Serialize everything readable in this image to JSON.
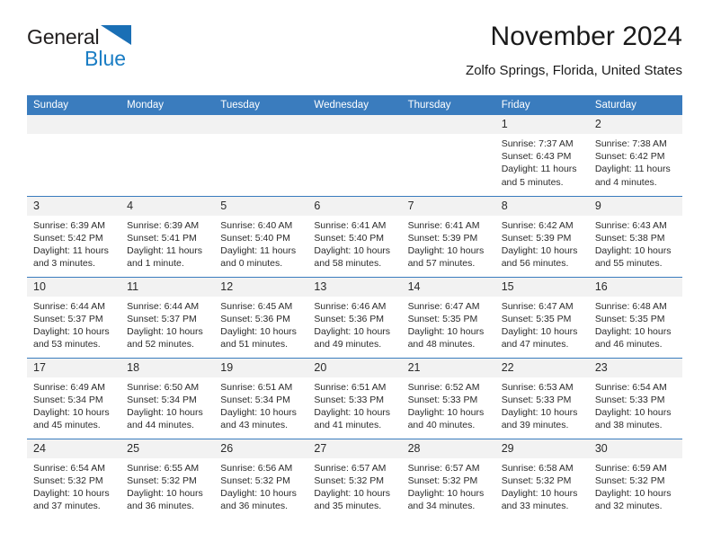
{
  "brand": {
    "name_part1": "General",
    "name_part2": "Blue",
    "logo_icon": "triangle-logo-icon",
    "accent_color": "#1a7dc4"
  },
  "header": {
    "title": "November 2024",
    "location": "Zolfo Springs, Florida, United States"
  },
  "theme": {
    "header_blue": "#3a7cbe",
    "daynum_bg": "#f2f2f2",
    "text": "#2b2b2b"
  },
  "calendar": {
    "weekday_headers": [
      "Sunday",
      "Monday",
      "Tuesday",
      "Wednesday",
      "Thursday",
      "Friday",
      "Saturday"
    ],
    "weeks": [
      [
        {
          "day": "",
          "sunrise": "",
          "sunset": "",
          "daylight_line1": "",
          "daylight_line2": ""
        },
        {
          "day": "",
          "sunrise": "",
          "sunset": "",
          "daylight_line1": "",
          "daylight_line2": ""
        },
        {
          "day": "",
          "sunrise": "",
          "sunset": "",
          "daylight_line1": "",
          "daylight_line2": ""
        },
        {
          "day": "",
          "sunrise": "",
          "sunset": "",
          "daylight_line1": "",
          "daylight_line2": ""
        },
        {
          "day": "",
          "sunrise": "",
          "sunset": "",
          "daylight_line1": "",
          "daylight_line2": ""
        },
        {
          "day": "1",
          "sunrise": "Sunrise: 7:37 AM",
          "sunset": "Sunset: 6:43 PM",
          "daylight_line1": "Daylight: 11 hours",
          "daylight_line2": "and 5 minutes."
        },
        {
          "day": "2",
          "sunrise": "Sunrise: 7:38 AM",
          "sunset": "Sunset: 6:42 PM",
          "daylight_line1": "Daylight: 11 hours",
          "daylight_line2": "and 4 minutes."
        }
      ],
      [
        {
          "day": "3",
          "sunrise": "Sunrise: 6:39 AM",
          "sunset": "Sunset: 5:42 PM",
          "daylight_line1": "Daylight: 11 hours",
          "daylight_line2": "and 3 minutes."
        },
        {
          "day": "4",
          "sunrise": "Sunrise: 6:39 AM",
          "sunset": "Sunset: 5:41 PM",
          "daylight_line1": "Daylight: 11 hours",
          "daylight_line2": "and 1 minute."
        },
        {
          "day": "5",
          "sunrise": "Sunrise: 6:40 AM",
          "sunset": "Sunset: 5:40 PM",
          "daylight_line1": "Daylight: 11 hours",
          "daylight_line2": "and 0 minutes."
        },
        {
          "day": "6",
          "sunrise": "Sunrise: 6:41 AM",
          "sunset": "Sunset: 5:40 PM",
          "daylight_line1": "Daylight: 10 hours",
          "daylight_line2": "and 58 minutes."
        },
        {
          "day": "7",
          "sunrise": "Sunrise: 6:41 AM",
          "sunset": "Sunset: 5:39 PM",
          "daylight_line1": "Daylight: 10 hours",
          "daylight_line2": "and 57 minutes."
        },
        {
          "day": "8",
          "sunrise": "Sunrise: 6:42 AM",
          "sunset": "Sunset: 5:39 PM",
          "daylight_line1": "Daylight: 10 hours",
          "daylight_line2": "and 56 minutes."
        },
        {
          "day": "9",
          "sunrise": "Sunrise: 6:43 AM",
          "sunset": "Sunset: 5:38 PM",
          "daylight_line1": "Daylight: 10 hours",
          "daylight_line2": "and 55 minutes."
        }
      ],
      [
        {
          "day": "10",
          "sunrise": "Sunrise: 6:44 AM",
          "sunset": "Sunset: 5:37 PM",
          "daylight_line1": "Daylight: 10 hours",
          "daylight_line2": "and 53 minutes."
        },
        {
          "day": "11",
          "sunrise": "Sunrise: 6:44 AM",
          "sunset": "Sunset: 5:37 PM",
          "daylight_line1": "Daylight: 10 hours",
          "daylight_line2": "and 52 minutes."
        },
        {
          "day": "12",
          "sunrise": "Sunrise: 6:45 AM",
          "sunset": "Sunset: 5:36 PM",
          "daylight_line1": "Daylight: 10 hours",
          "daylight_line2": "and 51 minutes."
        },
        {
          "day": "13",
          "sunrise": "Sunrise: 6:46 AM",
          "sunset": "Sunset: 5:36 PM",
          "daylight_line1": "Daylight: 10 hours",
          "daylight_line2": "and 49 minutes."
        },
        {
          "day": "14",
          "sunrise": "Sunrise: 6:47 AM",
          "sunset": "Sunset: 5:35 PM",
          "daylight_line1": "Daylight: 10 hours",
          "daylight_line2": "and 48 minutes."
        },
        {
          "day": "15",
          "sunrise": "Sunrise: 6:47 AM",
          "sunset": "Sunset: 5:35 PM",
          "daylight_line1": "Daylight: 10 hours",
          "daylight_line2": "and 47 minutes."
        },
        {
          "day": "16",
          "sunrise": "Sunrise: 6:48 AM",
          "sunset": "Sunset: 5:35 PM",
          "daylight_line1": "Daylight: 10 hours",
          "daylight_line2": "and 46 minutes."
        }
      ],
      [
        {
          "day": "17",
          "sunrise": "Sunrise: 6:49 AM",
          "sunset": "Sunset: 5:34 PM",
          "daylight_line1": "Daylight: 10 hours",
          "daylight_line2": "and 45 minutes."
        },
        {
          "day": "18",
          "sunrise": "Sunrise: 6:50 AM",
          "sunset": "Sunset: 5:34 PM",
          "daylight_line1": "Daylight: 10 hours",
          "daylight_line2": "and 44 minutes."
        },
        {
          "day": "19",
          "sunrise": "Sunrise: 6:51 AM",
          "sunset": "Sunset: 5:34 PM",
          "daylight_line1": "Daylight: 10 hours",
          "daylight_line2": "and 43 minutes."
        },
        {
          "day": "20",
          "sunrise": "Sunrise: 6:51 AM",
          "sunset": "Sunset: 5:33 PM",
          "daylight_line1": "Daylight: 10 hours",
          "daylight_line2": "and 41 minutes."
        },
        {
          "day": "21",
          "sunrise": "Sunrise: 6:52 AM",
          "sunset": "Sunset: 5:33 PM",
          "daylight_line1": "Daylight: 10 hours",
          "daylight_line2": "and 40 minutes."
        },
        {
          "day": "22",
          "sunrise": "Sunrise: 6:53 AM",
          "sunset": "Sunset: 5:33 PM",
          "daylight_line1": "Daylight: 10 hours",
          "daylight_line2": "and 39 minutes."
        },
        {
          "day": "23",
          "sunrise": "Sunrise: 6:54 AM",
          "sunset": "Sunset: 5:33 PM",
          "daylight_line1": "Daylight: 10 hours",
          "daylight_line2": "and 38 minutes."
        }
      ],
      [
        {
          "day": "24",
          "sunrise": "Sunrise: 6:54 AM",
          "sunset": "Sunset: 5:32 PM",
          "daylight_line1": "Daylight: 10 hours",
          "daylight_line2": "and 37 minutes."
        },
        {
          "day": "25",
          "sunrise": "Sunrise: 6:55 AM",
          "sunset": "Sunset: 5:32 PM",
          "daylight_line1": "Daylight: 10 hours",
          "daylight_line2": "and 36 minutes."
        },
        {
          "day": "26",
          "sunrise": "Sunrise: 6:56 AM",
          "sunset": "Sunset: 5:32 PM",
          "daylight_line1": "Daylight: 10 hours",
          "daylight_line2": "and 36 minutes."
        },
        {
          "day": "27",
          "sunrise": "Sunrise: 6:57 AM",
          "sunset": "Sunset: 5:32 PM",
          "daylight_line1": "Daylight: 10 hours",
          "daylight_line2": "and 35 minutes."
        },
        {
          "day": "28",
          "sunrise": "Sunrise: 6:57 AM",
          "sunset": "Sunset: 5:32 PM",
          "daylight_line1": "Daylight: 10 hours",
          "daylight_line2": "and 34 minutes."
        },
        {
          "day": "29",
          "sunrise": "Sunrise: 6:58 AM",
          "sunset": "Sunset: 5:32 PM",
          "daylight_line1": "Daylight: 10 hours",
          "daylight_line2": "and 33 minutes."
        },
        {
          "day": "30",
          "sunrise": "Sunrise: 6:59 AM",
          "sunset": "Sunset: 5:32 PM",
          "daylight_line1": "Daylight: 10 hours",
          "daylight_line2": "and 32 minutes."
        }
      ]
    ]
  }
}
